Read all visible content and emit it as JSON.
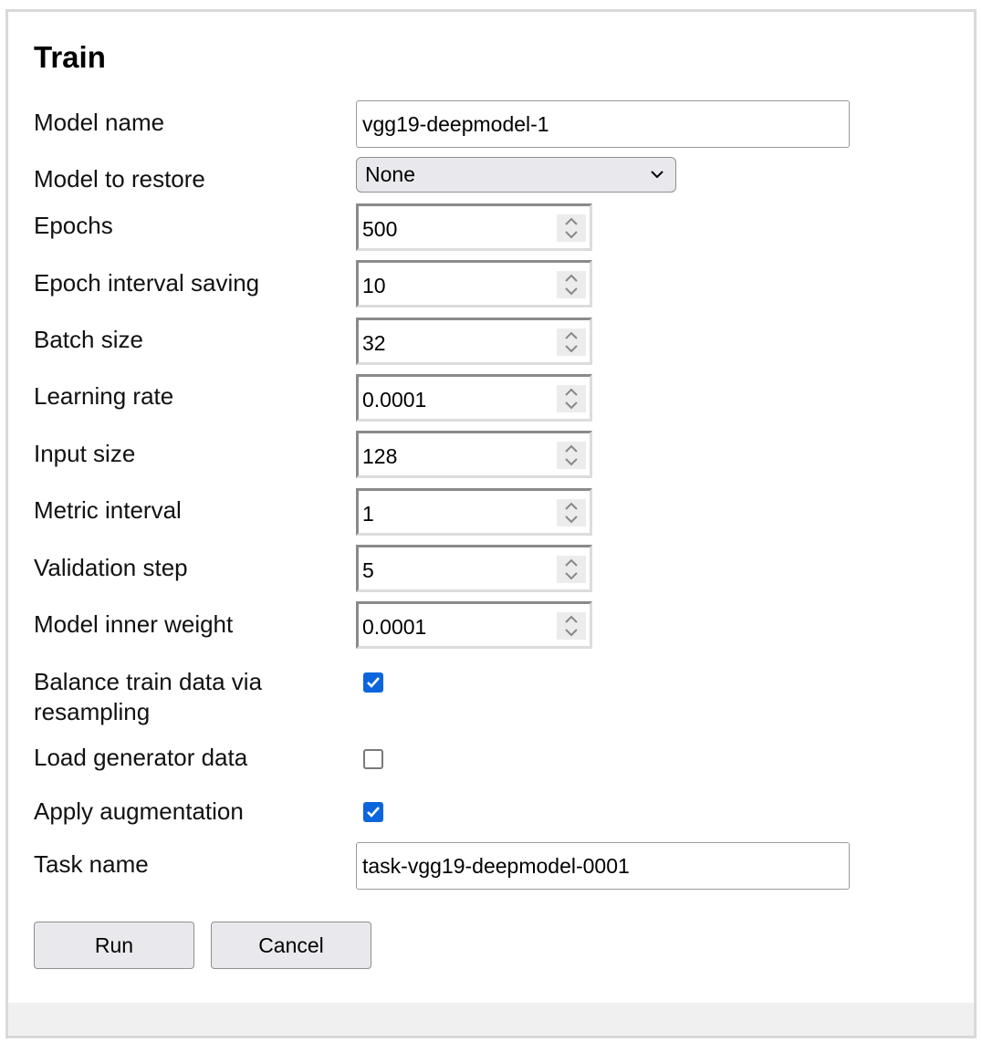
{
  "form": {
    "title": "Train",
    "fields": {
      "model_name": {
        "label": "Model name",
        "value": "vgg19-deepmodel-1"
      },
      "model_to_restore": {
        "label": "Model to restore",
        "selected": "None"
      },
      "epochs": {
        "label": "Epochs",
        "value": "500"
      },
      "epoch_interval_saving": {
        "label": "Epoch interval saving",
        "value": "10"
      },
      "batch_size": {
        "label": "Batch size",
        "value": "32"
      },
      "learning_rate": {
        "label": "Learning rate",
        "value": "0.0001"
      },
      "input_size": {
        "label": "Input size",
        "value": "128"
      },
      "metric_interval": {
        "label": "Metric interval",
        "value": "1"
      },
      "validation_step": {
        "label": "Validation step",
        "value": "5"
      },
      "model_inner_weight": {
        "label": "Model inner weight",
        "value": "0.0001"
      },
      "balance_train_data": {
        "label_line1": "Balance train data via",
        "label_line2": "resampling",
        "checked": true
      },
      "load_generator_data": {
        "label": "Load generator data",
        "checked": false
      },
      "apply_augmentation": {
        "label": "Apply augmentation",
        "checked": true
      },
      "task_name": {
        "label": "Task name",
        "value": "task-vgg19-deepmodel-0001"
      }
    },
    "buttons": {
      "run": "Run",
      "cancel": "Cancel"
    }
  },
  "colors": {
    "checkbox_accent": "#0b66dd",
    "button_bg": "#e9e9ed",
    "panel_border": "#d9d9d9",
    "footer_bg": "#f0f0f0"
  },
  "icons": {
    "select_arrow": "chevron-down-icon",
    "spinner": "spinner-arrows-icon",
    "checkmark": "checkmark-icon"
  }
}
